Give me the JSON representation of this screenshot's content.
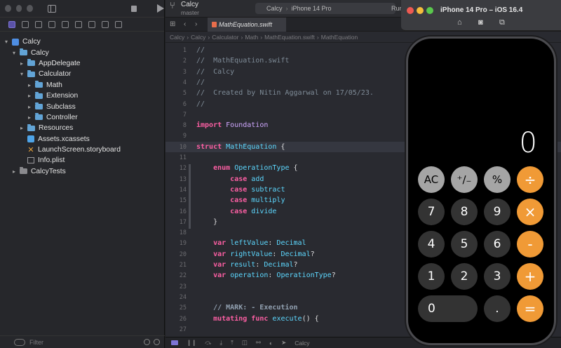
{
  "project": {
    "name": "Calcy",
    "branch": "master"
  },
  "scheme": {
    "target": "Calcy",
    "device": "iPhone 14 Pro",
    "run_label": "Run"
  },
  "editor": {
    "tab": "MathEquation.swift",
    "breadcrumbs": [
      "Calcy",
      "Calcy",
      "Calculator",
      "Math",
      "MathEquation.swift",
      "MathEquation"
    ],
    "lines": [
      {
        "n": "1",
        "text": "//"
      },
      {
        "n": "2",
        "text": "//  MathEquation.swift"
      },
      {
        "n": "3",
        "text": "//  Calcy"
      },
      {
        "n": "4",
        "text": "//"
      },
      {
        "n": "5",
        "text": "//  Created by Nitin Aggarwal on 17/05/23."
      },
      {
        "n": "6",
        "text": "//"
      },
      {
        "n": "7",
        "text": ""
      },
      {
        "n": "8",
        "text": "import Foundation"
      },
      {
        "n": "9",
        "text": ""
      },
      {
        "n": "10",
        "text": "struct MathEquation {"
      },
      {
        "n": "11",
        "text": ""
      },
      {
        "n": "12",
        "text": "    enum OperationType {"
      },
      {
        "n": "13",
        "text": "        case add"
      },
      {
        "n": "14",
        "text": "        case subtract"
      },
      {
        "n": "15",
        "text": "        case multiply"
      },
      {
        "n": "16",
        "text": "        case divide"
      },
      {
        "n": "17",
        "text": "    }"
      },
      {
        "n": "18",
        "text": ""
      },
      {
        "n": "19",
        "text": "    var leftValue: Decimal"
      },
      {
        "n": "20",
        "text": "    var rightValue: Decimal?"
      },
      {
        "n": "21",
        "text": "    var result: Decimal?"
      },
      {
        "n": "22",
        "text": "    var operation: OperationType?"
      },
      {
        "n": "23",
        "text": ""
      },
      {
        "n": "24",
        "text": ""
      },
      {
        "n": "25",
        "text": "    // MARK: - Execution"
      },
      {
        "n": "26",
        "text": "    mutating func execute() {"
      },
      {
        "n": "27",
        "text": ""
      }
    ],
    "highlighted_line": "10",
    "bottom_target": "Calcy"
  },
  "navigator": {
    "items": [
      {
        "label": "Calcy",
        "indent": 0,
        "icon": "app",
        "chev": "v"
      },
      {
        "label": "Calcy",
        "indent": 1,
        "icon": "folder",
        "chev": "v"
      },
      {
        "label": "AppDelegate",
        "indent": 2,
        "icon": "folder",
        "chev": ">"
      },
      {
        "label": "Calculator",
        "indent": 2,
        "icon": "folder",
        "chev": "v"
      },
      {
        "label": "Math",
        "indent": 3,
        "icon": "folder",
        "chev": ">"
      },
      {
        "label": "Extension",
        "indent": 3,
        "icon": "folder",
        "chev": ">"
      },
      {
        "label": "Subclass",
        "indent": 3,
        "icon": "folder",
        "chev": ">"
      },
      {
        "label": "Controller",
        "indent": 3,
        "icon": "folder",
        "chev": ">"
      },
      {
        "label": "Resources",
        "indent": 2,
        "icon": "folder",
        "chev": ">"
      },
      {
        "label": "Assets.xcassets",
        "indent": 2,
        "icon": "asset",
        "chev": ""
      },
      {
        "label": "LaunchScreen.storyboard",
        "indent": 2,
        "icon": "storyboard",
        "chev": ""
      },
      {
        "label": "Info.plist",
        "indent": 2,
        "icon": "plist",
        "chev": ""
      },
      {
        "label": "CalcyTests",
        "indent": 1,
        "icon": "folder-gray",
        "chev": ">"
      }
    ],
    "filter_placeholder": "Filter"
  },
  "simulator": {
    "title": "iPhone 14 Pro – iOS 16.4",
    "display": "0",
    "keys": [
      {
        "label": "AC",
        "style": "lite"
      },
      {
        "label": "⁺∕₋",
        "style": "lite"
      },
      {
        "label": "%",
        "style": "lite"
      },
      {
        "label": "÷",
        "style": "orange"
      },
      {
        "label": "7",
        "style": "dark"
      },
      {
        "label": "8",
        "style": "dark"
      },
      {
        "label": "9",
        "style": "dark"
      },
      {
        "label": "×",
        "style": "orange"
      },
      {
        "label": "4",
        "style": "dark"
      },
      {
        "label": "5",
        "style": "dark"
      },
      {
        "label": "6",
        "style": "dark"
      },
      {
        "label": "-",
        "style": "orange"
      },
      {
        "label": "1",
        "style": "dark"
      },
      {
        "label": "2",
        "style": "dark"
      },
      {
        "label": "3",
        "style": "dark"
      },
      {
        "label": "+",
        "style": "orange"
      },
      {
        "label": "0",
        "style": "dark wide"
      },
      {
        "label": ".",
        "style": "dark"
      },
      {
        "label": "=",
        "style": "orange"
      }
    ]
  },
  "colors": {
    "accent": "#7d74d6",
    "orange_key": "#f09a36",
    "keyword": "#fc5fa3"
  }
}
